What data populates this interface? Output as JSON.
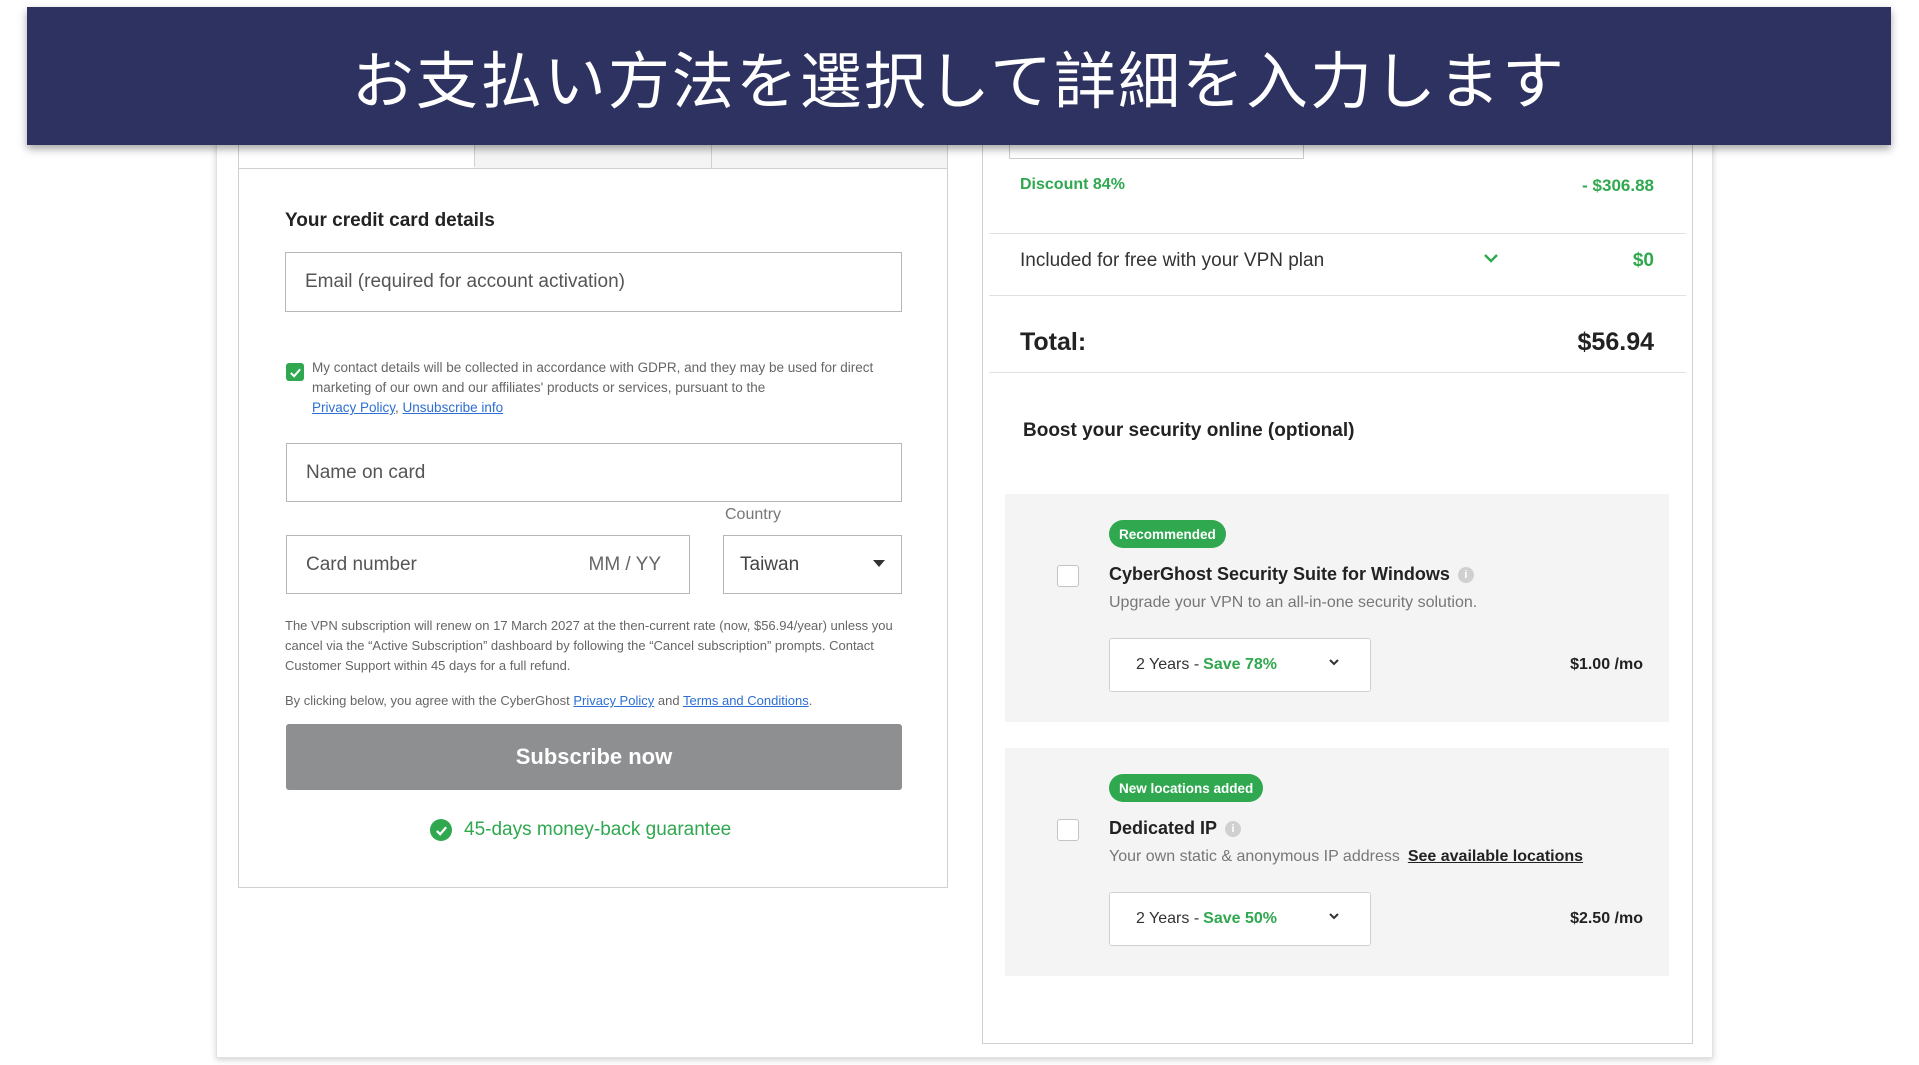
{
  "banner": {
    "title": "お支払い方法を選択して詳細を入力します"
  },
  "payment": {
    "heading": "Your credit card details",
    "email_placeholder": "Email (required for account activation)",
    "gdpr_text": "My contact details will be collected in accordance with GDPR, and they may be used for direct marketing of our own and our affiliates' products or services, pursuant to the",
    "privacy_policy_link": "Privacy Policy",
    "separator": ", ",
    "unsubscribe_link": "Unsubscribe info",
    "name_placeholder": "Name on card",
    "card_placeholder": "Card number",
    "expiry_placeholder": "MM / YY",
    "country_label": "Country",
    "country_value": "Taiwan",
    "renew_text": "The VPN subscription will renew on 17 March 2027 at the then-current rate (now, $56.94/year) unless you cancel via the “Active Subscription” dashboard by following the “Cancel subscription” prompts. Contact Customer Support within 45 days for a full refund.",
    "agree_prefix": "By clicking below, you agree with the CyberGhost",
    "agree_privacy": "Privacy Policy",
    "agree_and": "and",
    "agree_terms": "Terms and Conditions",
    "agree_suffix": ".",
    "subscribe_label": "Subscribe now",
    "guarantee": "45-days money-back guarantee"
  },
  "summary": {
    "discount_label": "Discount 84%",
    "discount_value": "- $306.88",
    "included_label": "Included for free with your VPN plan",
    "included_value": "$0",
    "total_label": "Total:",
    "total_value": "$56.94",
    "boost_heading": "Boost your security online (optional)"
  },
  "addons": [
    {
      "badge": "Recommended",
      "title": "CyberGhost Security Suite for Windows",
      "desc": "Upgrade your VPN to an all-in-one security solution.",
      "plan": "2 Years -",
      "save": "Save 78%",
      "price": "$1.00 /mo"
    },
    {
      "badge": "New locations added",
      "title": "Dedicated IP",
      "desc": "Your own static & anonymous IP address",
      "link": "See available locations",
      "plan": "2 Years -",
      "save": "Save 50%",
      "price": "$2.50 /mo"
    }
  ],
  "colors": {
    "banner": "#2e3260",
    "accent_green": "#2fa84f",
    "button_gray": "#8e8f91",
    "link_blue": "#2d6fd3"
  }
}
